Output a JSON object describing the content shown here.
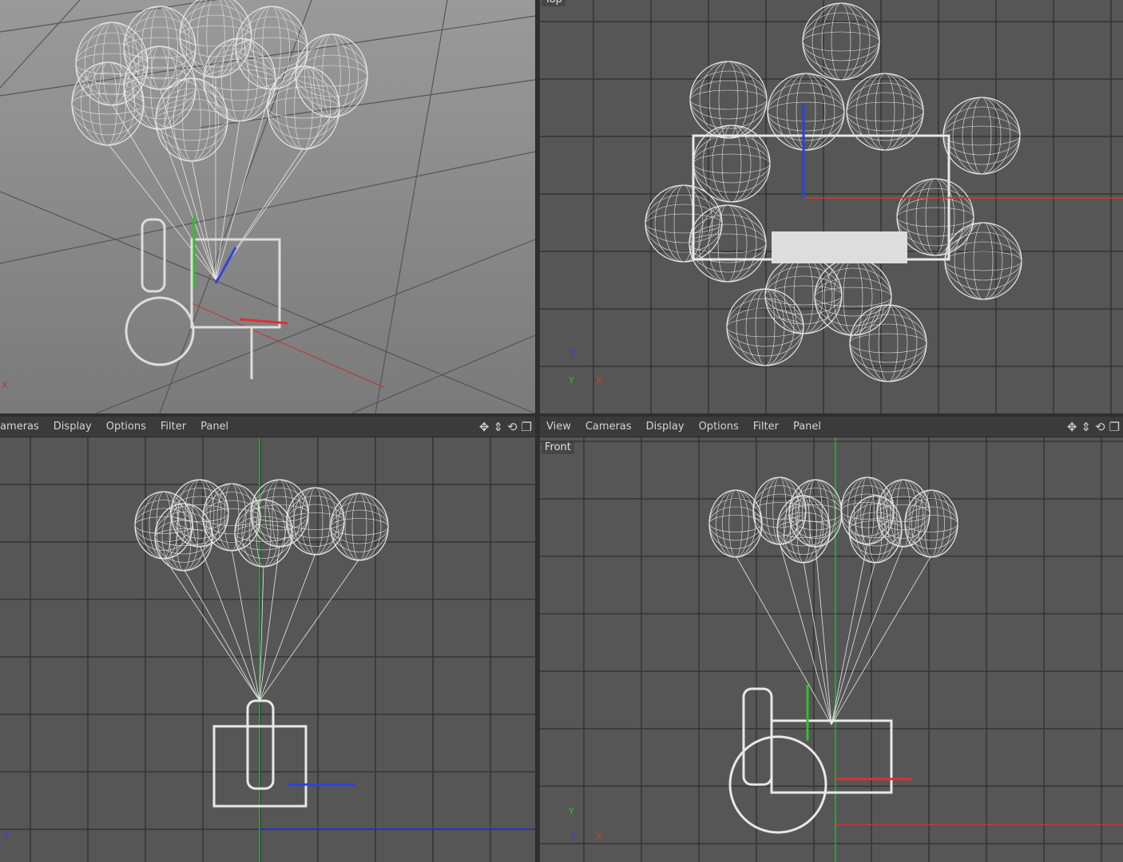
{
  "viewports": {
    "perspective": {
      "axis_label": "X"
    },
    "top": {
      "label": "Top",
      "axis_y": "Z",
      "axis_x": "X",
      "axis_origin": "Y"
    },
    "right": {
      "menu": [
        "Cameras",
        "Display",
        "Options",
        "Filter",
        "Panel"
      ],
      "axis_label": "Z"
    },
    "front": {
      "label": "Front",
      "menu": [
        "View",
        "Cameras",
        "Display",
        "Options",
        "Filter",
        "Panel"
      ],
      "axis_y": "Y",
      "axis_x": "X",
      "axis_origin": "Z"
    }
  },
  "view_icons": [
    "move-view-icon",
    "zoom-view-icon",
    "rotate-view-icon",
    "maximize-view-icon"
  ],
  "colors": {
    "x_axis": "#e03030",
    "y_axis": "#30c030",
    "z_axis": "#3040e0",
    "wire": "#e8e8e8",
    "grid_bg": "#575757"
  }
}
